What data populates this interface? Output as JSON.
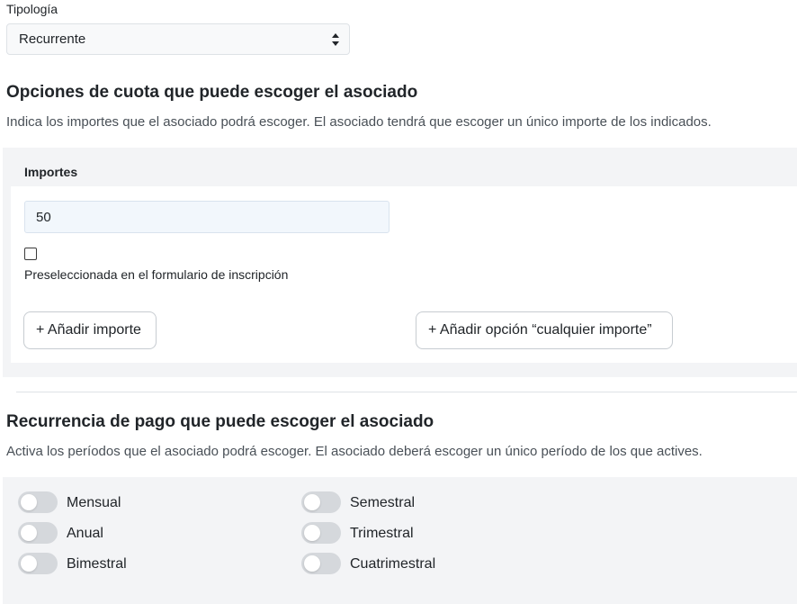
{
  "tipologia": {
    "label": "Tipología",
    "selected": "Recurrente"
  },
  "cuota": {
    "title": "Opciones de cuota que puede escoger el asociado",
    "description": "Indica los importes que el asociado podrá escoger. El asociado tendrá que escoger un único importe de los indicados.",
    "importes_label": "Importes",
    "amount_value": "50",
    "preselected_label": "Preseleccionada en el formulario de inscripción",
    "preselected_checked": false,
    "add_amount_button": "+ Añadir importe",
    "add_any_amount_button": "+ Añadir opción “cualquier importe”"
  },
  "recurrencia": {
    "title": "Recurrencia de pago que puede escoger el asociado",
    "description": "Activa los períodos que el asociado podrá escoger. El asociado deberá escoger un único período de los que actives.",
    "periods": [
      {
        "label": "Mensual",
        "enabled": false
      },
      {
        "label": "Anual",
        "enabled": false
      },
      {
        "label": "Bimestral",
        "enabled": false
      },
      {
        "label": "Semestral",
        "enabled": false
      },
      {
        "label": "Trimestral",
        "enabled": false
      },
      {
        "label": "Cuatrimestral",
        "enabled": false
      }
    ]
  },
  "colors": {
    "toggle_off": "#d5d8dc",
    "panel_bg": "#f3f4f6",
    "input_bg": "#f2f7fc"
  }
}
